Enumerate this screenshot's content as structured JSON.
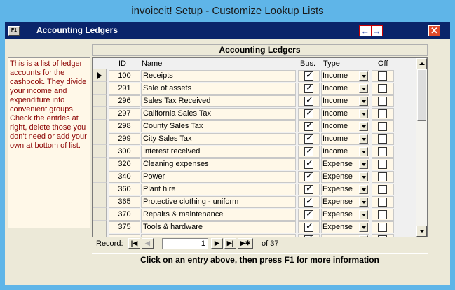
{
  "window": {
    "title": "invoiceit! Setup - Customize Lookup Lists"
  },
  "form": {
    "f1_label": "F1",
    "title": "Accounting Ledgers",
    "prev_icon": "arrow-left-icon",
    "next_icon": "arrow-right-icon",
    "close_icon": "close-icon",
    "colors": {
      "header_bg": "#0a246a",
      "help_text": "#8b0000",
      "cell_bg": "#fff8e8"
    }
  },
  "help_text": "This is a list of ledger accounts for the cashbook. They divide your income and expenditure into convenient groups. Check the entries at right, delete those you don't need or add your own at bottom of list.",
  "grid": {
    "title": "Accounting Ledgers",
    "columns": {
      "id": "ID",
      "name": "Name",
      "bus": "Bus.",
      "type": "Type",
      "off": "Off"
    },
    "rows": [
      {
        "id": "100",
        "name": "Receipts",
        "bus": true,
        "type": "Income",
        "off": false
      },
      {
        "id": "291",
        "name": "Sale of assets",
        "bus": true,
        "type": "Income",
        "off": false
      },
      {
        "id": "296",
        "name": "Sales Tax Received",
        "bus": true,
        "type": "Income",
        "off": false
      },
      {
        "id": "297",
        "name": "California Sales Tax",
        "bus": true,
        "type": "Income",
        "off": false
      },
      {
        "id": "298",
        "name": "County Sales Tax",
        "bus": true,
        "type": "Income",
        "off": false
      },
      {
        "id": "299",
        "name": "City Sales Tax",
        "bus": true,
        "type": "Income",
        "off": false
      },
      {
        "id": "300",
        "name": "Interest received",
        "bus": true,
        "type": "Income",
        "off": false
      },
      {
        "id": "320",
        "name": "Cleaning expenses",
        "bus": true,
        "type": "Expense",
        "off": false
      },
      {
        "id": "340",
        "name": "Power",
        "bus": true,
        "type": "Expense",
        "off": false
      },
      {
        "id": "360",
        "name": "Plant hire",
        "bus": true,
        "type": "Expense",
        "off": false
      },
      {
        "id": "365",
        "name": "Protective clothing - uniform",
        "bus": true,
        "type": "Expense",
        "off": false
      },
      {
        "id": "370",
        "name": "Repairs & maintenance",
        "bus": true,
        "type": "Expense",
        "off": false
      },
      {
        "id": "375",
        "name": "Tools & hardware",
        "bus": true,
        "type": "Expense",
        "off": false
      },
      {
        "id": "",
        "name": "",
        "bus": true,
        "type": "",
        "off": false
      }
    ]
  },
  "navigation": {
    "label": "Record:",
    "current": "1",
    "of_text": "of  37",
    "first_icon": "first-record-icon",
    "prev_icon": "prev-record-icon",
    "next_icon": "next-record-icon",
    "last_icon": "last-record-icon",
    "new_icon": "new-record-icon"
  },
  "footer": {
    "message": "Click on an entry above, then press F1 for more information"
  }
}
